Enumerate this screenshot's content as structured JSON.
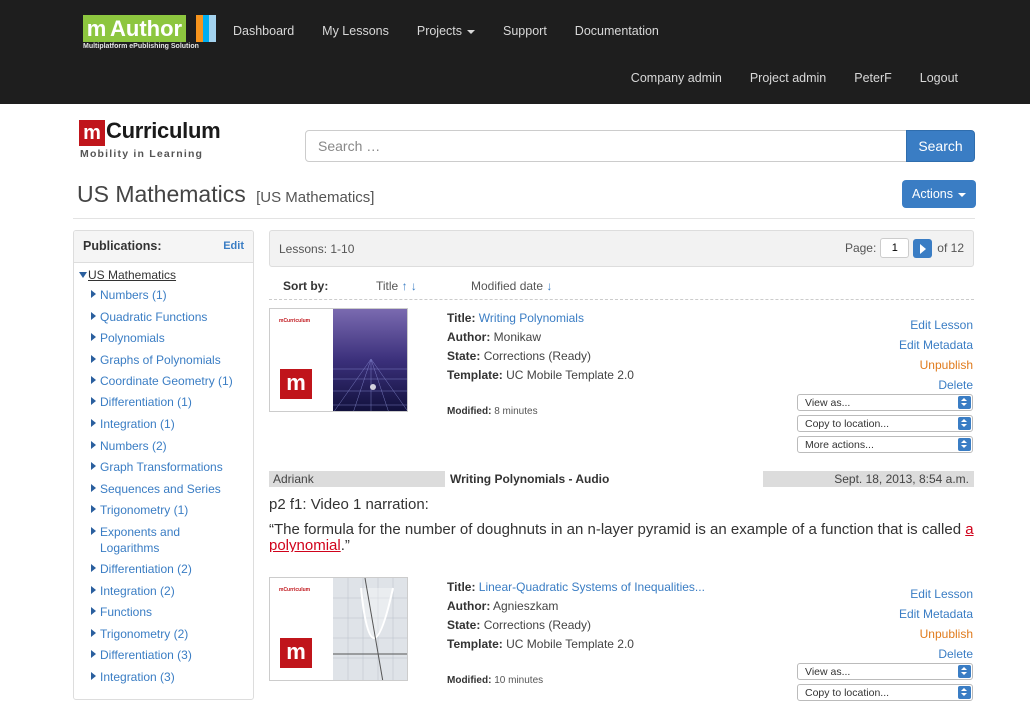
{
  "app": {
    "logo_letter": "m",
    "logo_word": "Author",
    "logo_tagline": "Multiplatform ePublishing Solution",
    "logo_stripe_colors": [
      "#8dc63f",
      "#f7941d",
      "#00aeef",
      "#a4d3ee"
    ]
  },
  "nav": {
    "primary": [
      "Dashboard",
      "My Lessons",
      "Projects",
      "Support",
      "Documentation"
    ],
    "secondary": [
      "Company admin",
      "Project admin",
      "PeterF",
      "Logout"
    ]
  },
  "brand": {
    "letter": "m",
    "word": "Curriculum",
    "tagline": "Mobility in Learning"
  },
  "search": {
    "placeholder": "Search …",
    "button": "Search"
  },
  "page": {
    "title": "US Mathematics",
    "subtitle": "[US Mathematics]",
    "actions": "Actions"
  },
  "sidebar": {
    "heading": "Publications:",
    "edit": "Edit",
    "root": "US Mathematics",
    "items": [
      "Numbers (1)",
      "Quadratic Functions",
      "Polynomials",
      "Graphs of Polynomials",
      "Coordinate Geometry (1)",
      "Differentiation (1)",
      "Integration (1)",
      "Numbers (2)",
      "Graph Transformations",
      "Sequences and Series",
      "Trigonometry (1)",
      "Exponents and Logarithms",
      "Differentiation (2)",
      "Integration (2)",
      "Functions",
      "Trigonometry (2)",
      "Differentiation (3)",
      "Integration (3)"
    ]
  },
  "list": {
    "count": "Lessons: 1-10",
    "page_label": "Page:",
    "page_value": "1",
    "of_pages": "of 12",
    "sort_label": "Sort by:",
    "sort_title": "Title",
    "sort_title_arrows": "↑ ↓",
    "sort_modified": "Modified date",
    "sort_modified_arrow": "↓"
  },
  "labels": {
    "title": "Title:",
    "author": "Author:",
    "state": "State:",
    "template": "Template:",
    "modified": "Modified:",
    "thumb_brand": "mCurriculum"
  },
  "lessons": [
    {
      "title": "Writing Polynomials",
      "author": "Monikaw",
      "state": "Corrections (Ready)",
      "template": "UC Mobile Template 2.0",
      "modified": "8 minutes",
      "actions": [
        "Edit Lesson",
        "Edit Metadata",
        "Unpublish",
        "Delete"
      ],
      "selects": [
        "View as...",
        "Copy to location...",
        "More actions..."
      ]
    },
    {
      "title": "Linear-Quadratic Systems of Inequalities...",
      "author": "Agnieszkam",
      "state": "Corrections (Ready)",
      "template": "UC Mobile Template 2.0",
      "modified": "10 minutes",
      "actions": [
        "Edit Lesson",
        "Edit Metadata",
        "Unpublish",
        "Delete"
      ],
      "selects": [
        "View as...",
        "Copy to location..."
      ]
    }
  ],
  "comment": {
    "user": "Adriank",
    "title": "Writing Polynomials - Audio",
    "date": "Sept. 18, 2013, 8:54 a.m.",
    "location": "p2 f1: Video 1 narration:",
    "text_before": "“The formula for the number of doughnuts in an n-layer pyramid is an example of a function that is called ",
    "text_highlight": "a polynomial",
    "text_after": ".”"
  },
  "colors": {
    "topbar": "#1e1e1e",
    "accent": "#3a7dc4",
    "warn": "#e07b1d",
    "brand_red": "#c0151b"
  }
}
